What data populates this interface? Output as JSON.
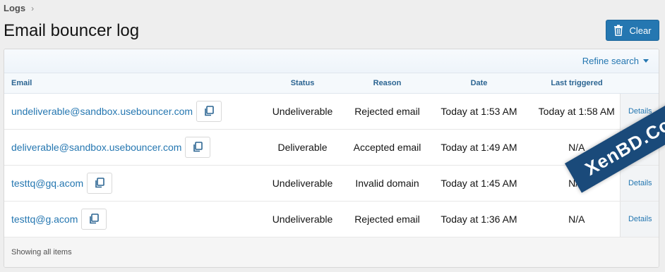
{
  "breadcrumb": {
    "item": "Logs"
  },
  "page": {
    "title": "Email bouncer log"
  },
  "actions": {
    "clear_label": "Clear"
  },
  "filter": {
    "refine_label": "Refine search"
  },
  "table": {
    "columns": {
      "email": "Email",
      "status": "Status",
      "reason": "Reason",
      "date": "Date",
      "last_triggered": "Last triggered"
    },
    "rows": [
      {
        "email": "undeliverable@sandbox.usebouncer.com",
        "status": "Undeliverable",
        "reason": "Rejected email",
        "date": "Today at 1:53 AM",
        "last_triggered": "Today at 1:58 AM",
        "details": "Details"
      },
      {
        "email": "deliverable@sandbox.usebouncer.com",
        "status": "Deliverable",
        "reason": "Accepted email",
        "date": "Today at 1:49 AM",
        "last_triggered": "N/A",
        "details": "Details"
      },
      {
        "email": "testtq@gq.acom",
        "status": "Undeliverable",
        "reason": "Invalid domain",
        "date": "Today at 1:45 AM",
        "last_triggered": "N/A",
        "details": "Details"
      },
      {
        "email": "testtq@g.acom",
        "status": "Undeliverable",
        "reason": "Rejected email",
        "date": "Today at 1:36 AM",
        "last_triggered": "N/A",
        "details": "Details"
      }
    ]
  },
  "footer": {
    "text": "Showing all items"
  },
  "watermark": {
    "text": "XenBD.Com"
  },
  "colors": {
    "accent": "#2577b1",
    "header_text": "#2c6592",
    "watermark_bg": "#1a4a7a"
  },
  "icons": {
    "breadcrumb_separator": "chevron-right-icon",
    "clear": "trash-icon",
    "copy": "copy-icon",
    "refine": "caret-down-icon"
  }
}
